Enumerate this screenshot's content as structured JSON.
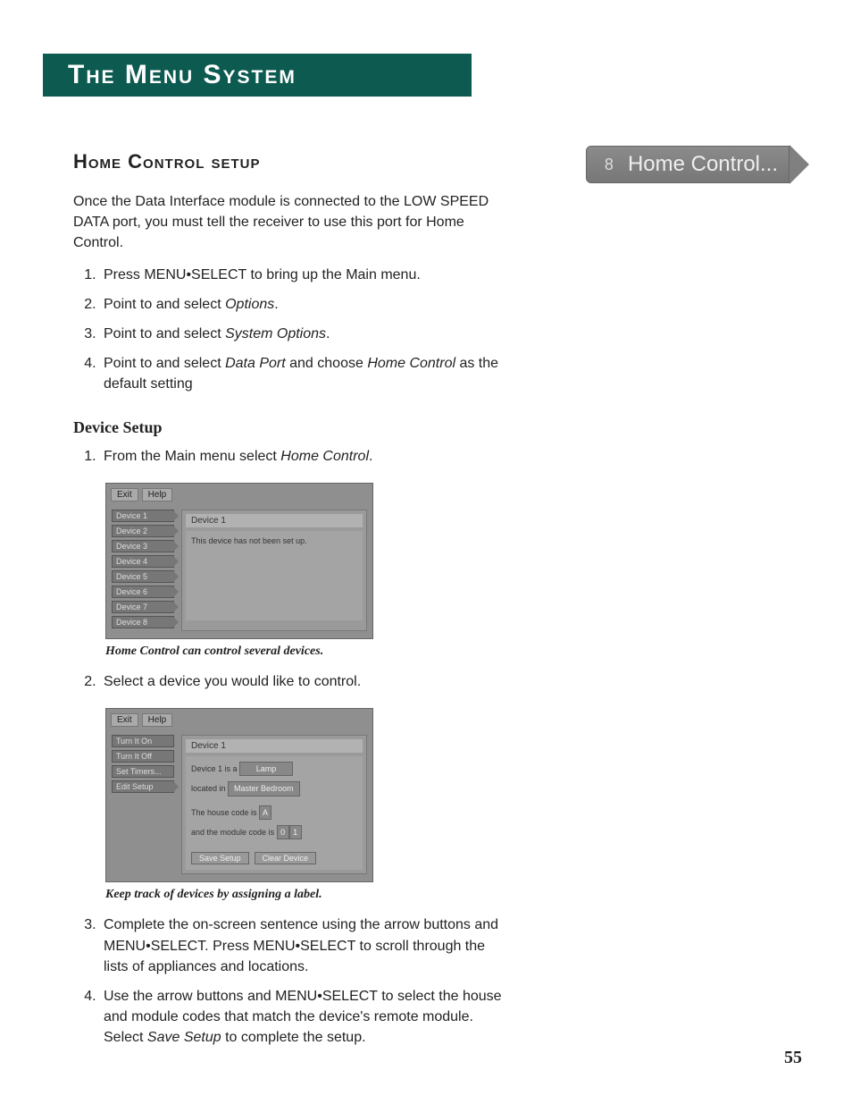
{
  "chapter": {
    "title": "The Menu System"
  },
  "pill": {
    "icon": "8",
    "label": "Home Control..."
  },
  "section": {
    "title": "Home Control setup",
    "intro": "Once the Data Interface module is connected to the LOW SPEED DATA port, you must tell the receiver to use this port for Home Control.",
    "steps": [
      {
        "text": "Press MENU•SELECT to bring up the Main menu."
      },
      {
        "pre": "Point to and select ",
        "em": "Options",
        "post": "."
      },
      {
        "pre": "Point to and select ",
        "em": "System Options",
        "post": "."
      },
      {
        "pre": "Point to and select ",
        "em": "Data Port",
        "mid": " and choose ",
        "em2": "Home Control",
        "post": " as the default setting"
      }
    ]
  },
  "deviceSetup": {
    "heading": "Device Setup",
    "step1": {
      "pre": "From the Main menu select ",
      "em": "Home Control",
      "post": "."
    },
    "shot1": {
      "exit": "Exit",
      "help": "Help",
      "devices": [
        "Device 1",
        "Device 2",
        "Device 3",
        "Device 4",
        "Device 5",
        "Device 6",
        "Device 7",
        "Device 8"
      ],
      "header": "Device 1",
      "body": "This device has not been set up."
    },
    "caption1": "Home Control can control several devices.",
    "step2": "Select a device you would like to control.",
    "shot2": {
      "exit": "Exit",
      "help": "Help",
      "side": [
        "Turn It On",
        "Turn It Off",
        "Set Timers...",
        "Edit Setup"
      ],
      "header": "Device 1",
      "line1a": "Device 1 is a",
      "field1": "Lamp",
      "line2a": "located in",
      "field2": "Master Bedroom",
      "line3": "The house code is",
      "fieldHouse": "A",
      "line4": "and the module code is",
      "fieldMod1": "0",
      "fieldMod2": "1",
      "save": "Save Setup",
      "clear": "Clear Device"
    },
    "caption2": "Keep track of devices by assigning a label.",
    "step3": "Complete the on-screen sentence using the arrow buttons and MENU•SELECT. Press MENU•SELECT to scroll through the lists of appliances and locations.",
    "step4": {
      "pre": "Use the arrow buttons and MENU•SELECT to select the house and module codes that match the device's remote module. Select ",
      "em": "Save Setup",
      "post": " to complete the setup."
    }
  },
  "pageNumber": "55"
}
